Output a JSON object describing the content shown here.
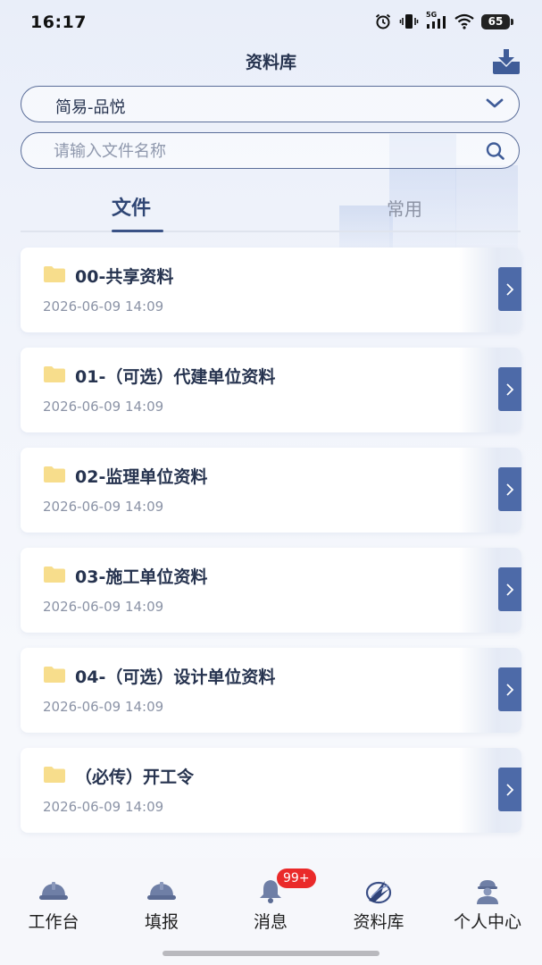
{
  "status_bar": {
    "time": "16:17",
    "network": "5G",
    "battery": "65",
    "icons": [
      "alarm-icon",
      "vibrate-icon",
      "signal-icon",
      "wifi-icon",
      "battery-icon"
    ]
  },
  "header": {
    "title": "资料库",
    "download_icon": "download-icon"
  },
  "project_select": {
    "value": "简易-品悦",
    "icon": "chevron-down-icon"
  },
  "search": {
    "placeholder": "请输入文件名称",
    "value": "",
    "icon": "search-icon"
  },
  "tabs": [
    {
      "label": "文件",
      "active": true
    },
    {
      "label": "常用",
      "active": false
    }
  ],
  "files": [
    {
      "name": "00-共享资料",
      "date": "2026-06-09 14:09"
    },
    {
      "name": "01-（可选）代建单位资料",
      "date": "2026-06-09 14:09"
    },
    {
      "name": "02-监理单位资料",
      "date": "2026-06-09 14:09"
    },
    {
      "name": "03-施工单位资料",
      "date": "2026-06-09 14:09"
    },
    {
      "name": "04-（可选）设计单位资料",
      "date": "2026-06-09 14:09"
    },
    {
      "name": "（必传）开工令",
      "date": "2026-06-09 14:09"
    }
  ],
  "bottom_nav": {
    "items": [
      {
        "label": "工作台",
        "icon": "hard-hat-icon"
      },
      {
        "label": "填报",
        "icon": "hard-hat-icon"
      },
      {
        "label": "消息",
        "icon": "bell-icon",
        "badge": "99+"
      },
      {
        "label": "资料库",
        "icon": "library-logo-icon"
      },
      {
        "label": "个人中心",
        "icon": "worker-avatar-icon"
      }
    ]
  },
  "colors": {
    "accent": "#4d6aa8",
    "title_text": "#26334f",
    "muted_text": "#8b93a6",
    "badge": "#ea2a2a",
    "folder": "#f7dd8c"
  }
}
